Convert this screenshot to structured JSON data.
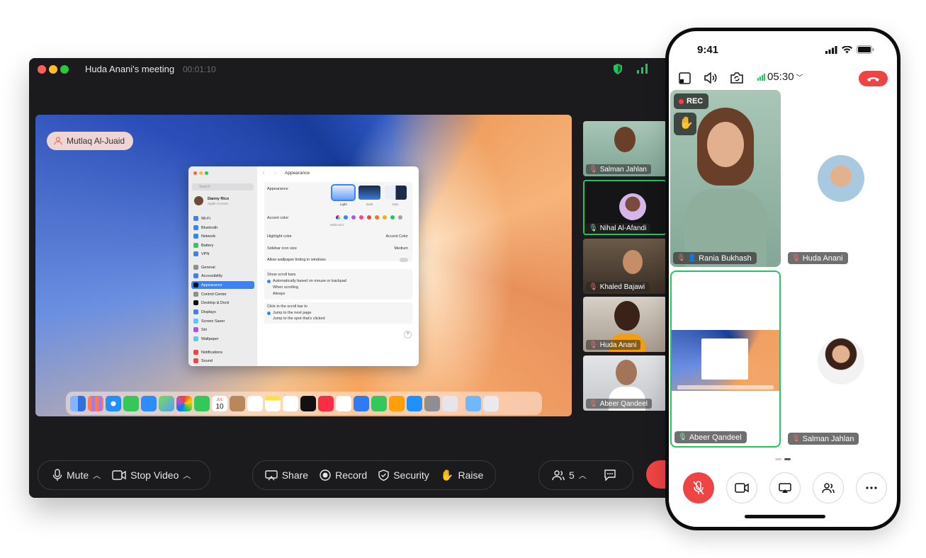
{
  "desktop": {
    "title": "Huda Anani's meeting",
    "elapsed": "00:01:10",
    "presenter": "Mutlaq Al-Juaid",
    "shared_screen": {
      "window_title": "Appearance",
      "search_placeholder": "Search",
      "user_name": "Danny Rico",
      "user_sub": "Apple Account",
      "sidebar": [
        "Wi-Fi",
        "Bluetooth",
        "Network",
        "Battery",
        "VPN",
        "General",
        "Accessibility",
        "Appearance",
        "Control Center",
        "Desktop & Dock",
        "Displays",
        "Screen Saver",
        "Siri",
        "Wallpaper",
        "Notifications",
        "Sound"
      ],
      "appearance_label": "Appearance",
      "themes": [
        "Light",
        "Dark",
        "Auto"
      ],
      "accent_label": "Accent color",
      "accent_sub": "Multicolor",
      "highlight_label": "Highlight color",
      "highlight_value": "Accent Color",
      "sidebar_icon_label": "Sidebar icon size",
      "sidebar_icon_value": "Medium",
      "tinting_label": "Allow wallpaper tinting in windows",
      "scroll_label": "Show scroll bars",
      "scroll_options": [
        "Automatically based on mouse or trackpad",
        "When scrolling",
        "Always"
      ],
      "click_label": "Click in the scroll bar to",
      "click_options": [
        "Jump to the next page",
        "Jump to the spot that's clicked"
      ],
      "help": "?",
      "calendar_day": "10",
      "calendar_month": "JUL"
    },
    "participants": [
      "Salman Jahlan",
      "Nihal Al-Afandi",
      "Khaled Bajawi",
      "Huda Anani",
      "Abeer Qandeel"
    ],
    "toolbar": {
      "mute": "Mute",
      "stop_video": "Stop Video",
      "share": "Share",
      "record": "Record",
      "security": "Security",
      "raise": "Raise",
      "participant_count": "5"
    }
  },
  "phone": {
    "clock": "9:41",
    "duration": "05:30",
    "rec": "REC",
    "tiles": {
      "main": "Rania Bukhash",
      "top_right": "Huda Anani",
      "share": "Abeer Qandeel",
      "bottom_right": "Salman Jahlan"
    }
  },
  "colors": {
    "end_call": "#ef4444",
    "active_speaker": "#22c55e",
    "window_bg": "#1b1b1d"
  }
}
